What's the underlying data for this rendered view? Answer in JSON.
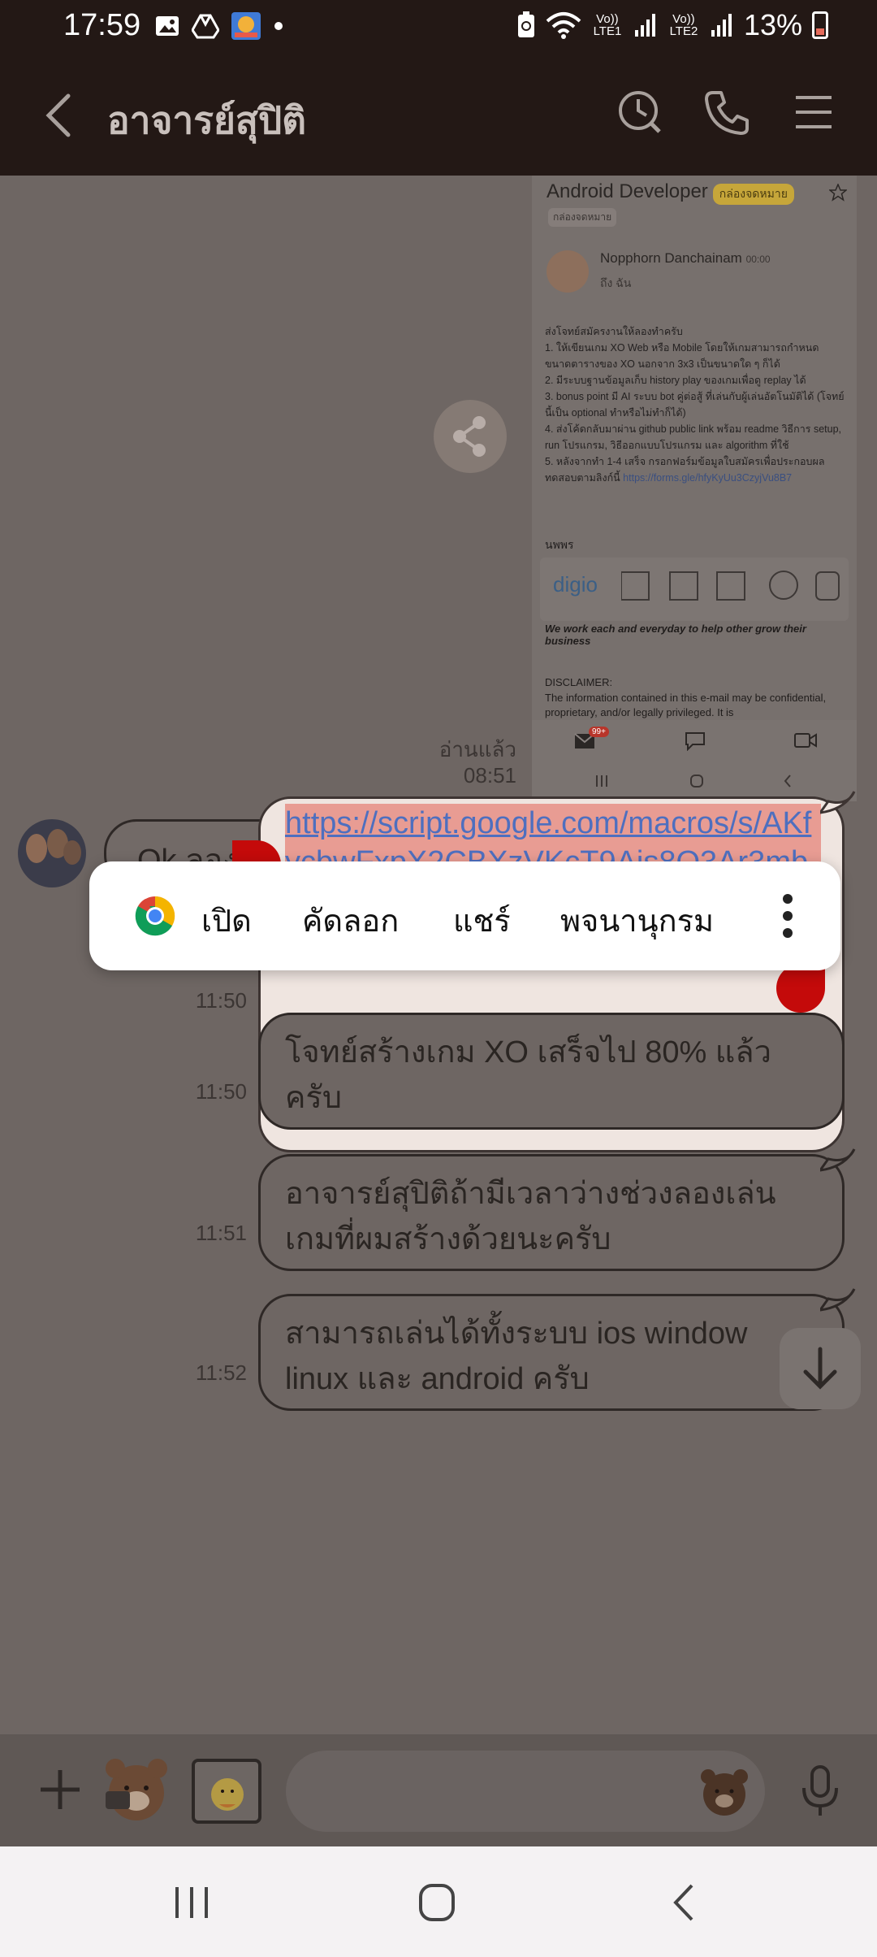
{
  "status": {
    "time": "17:59",
    "sim1": "Vo)) LTE1",
    "sim2": "Vo)) LTE2",
    "battery": "13%"
  },
  "header": {
    "title": "อาจารย์สุปิติ"
  },
  "screenshot": {
    "title": "Android Developer",
    "tag": "กล่องจดหมาย",
    "subtag": "กล่องจดหมาย",
    "sender": "Nopphorn Danchainam",
    "sender_time": "00:00",
    "to": "ถึง ฉัน",
    "body": "ส่งโจทย์สมัครงานให้ลองทำครับ\n1. ให้เขียนเกม XO Web หรือ Mobile โดยให้เกมสามารถกำหนด ขนาดตารางของ XO นอกจาก 3x3 เป็นขนาดใด ๆ ก็ได้\n2. มีระบบฐานข้อมูลเก็บ history play ของเกมเพื่อดู replay ได้\n3. bonus point มี AI ระบบ bot คู่ต่อสู้ ที่เล่นกับผู้เล่นอัตโนมัติได้ (โจทย์นี้เป็น optional ทำหรือไม่ทำก็ได้)\n4. ส่งโค้ดกลับมาผ่าน github public link พร้อม readme วิธีการ setup, run โปรแกรม, วิธีออกแบบโปรแกรม และ algorithm ที่ใช้\n5. หลังจากทำ 1-4 เสร็จ กรอกฟอร์มข้อมูลใบสมัครเพื่อประกอบผลทดสอบตามลิงก์นี้",
    "form_link": "https://forms.gle/hfyKyUu3CzyjVu8B7",
    "sign": "นพพร",
    "logo": "digio",
    "tagline": "We work each and everyday to help other grow their business",
    "disclaimer_title": "DISCLAIMER:",
    "disclaimer": "The information contained in this e-mail may be confidential, proprietary, and/or legally privileged. It is",
    "badge": "99+"
  },
  "chat": {
    "read_label": "อ่านแล้ว",
    "read_time": "08:51",
    "incoming_text": "Ok ลองดูครับ แล้วก็พัฒนาความรู้ใหม่ๆ",
    "link_text": "https://script.google.com/macros/s/AKfycbwFxpX2CBXzVKcT9Ajs8O3Ar3mbDdu2zfXGg1w-26YOpwc_pVj4saJZNxO5mzt70KQD/exec",
    "messages": [
      {
        "time": "11:50",
        "text": ""
      },
      {
        "time": "11:50",
        "text": "โจทย์สร้างเกม XO เสร็จไป 80% แล้วครับ"
      },
      {
        "time": "11:51",
        "text": "อาจารย์สุปิติถ้ามีเวลาว่างช่วงลองเล่นเกมที่ผมสร้างด้วยนะครับ"
      },
      {
        "time": "11:52",
        "text": "สามารถเล่นได้ทั้งระบบ ios window linux และ android ครับ"
      }
    ]
  },
  "popup": {
    "open": "เปิด",
    "copy": "คัดลอก",
    "share": "แชร์",
    "dictionary": "พจนานุกรม"
  },
  "colors": {
    "header_bg": "#231815",
    "link": "#4e6fbf",
    "selection": "#e89c93",
    "handle": "#c40a0a"
  }
}
